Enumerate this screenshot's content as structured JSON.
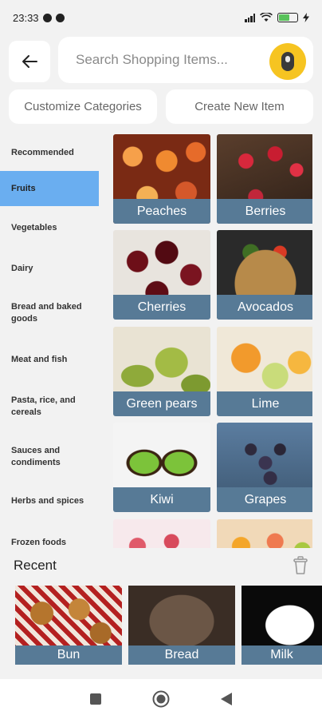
{
  "status_bar": {
    "time": "23:33",
    "battery_level": 0.6,
    "battery_color": "#58c25a"
  },
  "header": {
    "back_icon": "arrow-left-icon",
    "search_placeholder": "Search Shopping Items...",
    "mic_icon": "microphone-icon",
    "mic_color": "#f6c421"
  },
  "actions": {
    "customize_label": "Customize Categories",
    "create_label": "Create New Item"
  },
  "sidebar": {
    "active_index": 1,
    "active_color": "#6aaef0",
    "items": [
      {
        "label": "Recommended"
      },
      {
        "label": "Fruits"
      },
      {
        "label": "Vegetables"
      },
      {
        "label": "Dairy"
      },
      {
        "label": "Bread and baked goods"
      },
      {
        "label": "Meat and fish"
      },
      {
        "label": "Pasta, rice, and cereals"
      },
      {
        "label": "Sauces and condiments"
      },
      {
        "label": "Herbs and spices"
      },
      {
        "label": "Frozen foods"
      }
    ]
  },
  "grid": {
    "label_color": "#577a96",
    "items": [
      {
        "label": "Peaches",
        "image": "peaches"
      },
      {
        "label": "Berries",
        "image": "berries"
      },
      {
        "label": "Cherries",
        "image": "cherries"
      },
      {
        "label": "Avocados",
        "image": "avocados"
      },
      {
        "label": "Green pears",
        "image": "pears"
      },
      {
        "label": "Lime",
        "image": "lime"
      },
      {
        "label": "Kiwi",
        "image": "kiwi"
      },
      {
        "label": "Grapes",
        "image": "grapes"
      },
      {
        "label": "",
        "image": "pomegranate"
      },
      {
        "label": "",
        "image": "citrus"
      }
    ]
  },
  "recent": {
    "title": "Recent",
    "trash_icon": "trash-icon",
    "items": [
      {
        "label": "Bun",
        "image": "bun"
      },
      {
        "label": "Bread",
        "image": "bread"
      },
      {
        "label": "Milk",
        "image": "milk"
      }
    ]
  },
  "nav": {
    "square_icon": "recents-square-icon",
    "home_icon": "home-circle-icon",
    "back_icon": "back-triangle-icon"
  }
}
